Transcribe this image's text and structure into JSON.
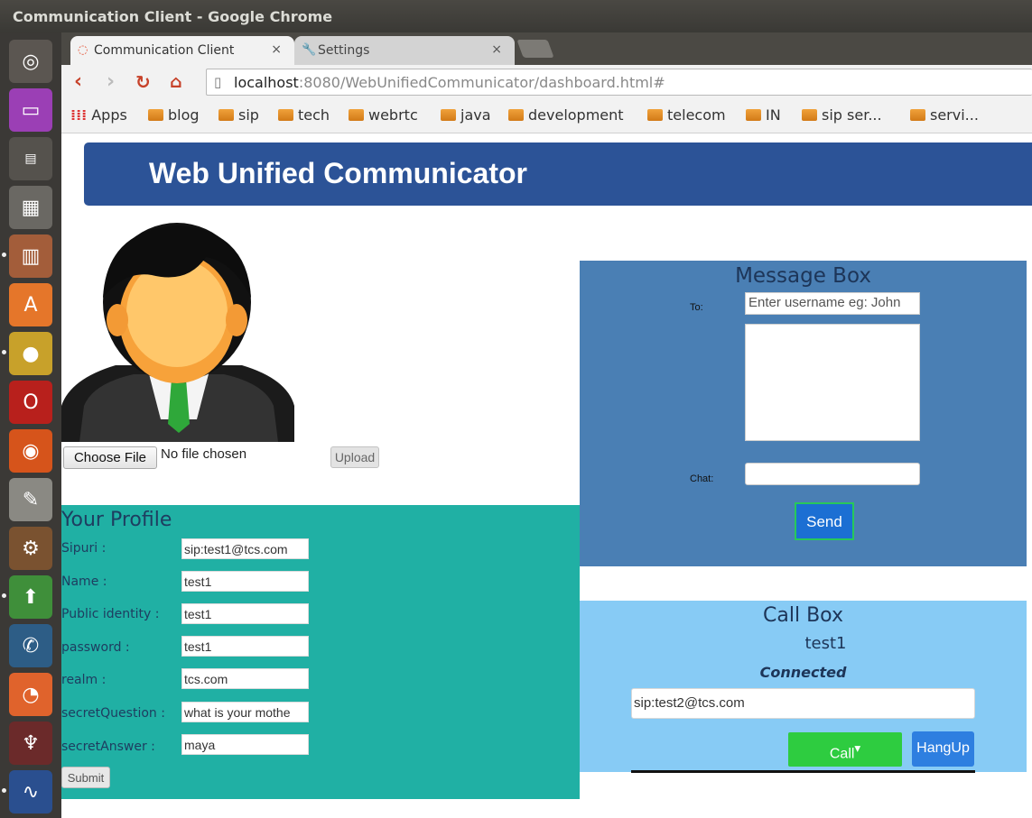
{
  "window": {
    "title": "Communication Client - Google Chrome"
  },
  "tabs": [
    {
      "label": "Communication Client",
      "close": "×"
    },
    {
      "label": "Settings",
      "close": "×"
    }
  ],
  "address_bar": {
    "host": "localhost",
    "rest": ":8080/WebUnifiedCommunicator/dashboard.html#"
  },
  "bookmarks": [
    "Apps",
    "blog",
    "sip",
    "tech",
    "webrtc",
    "java",
    "development",
    "telecom",
    "IN",
    "sip ser...",
    "servi..."
  ],
  "header": {
    "title": "Web Unified Communicator"
  },
  "upload": {
    "choose_label": "Choose File",
    "status": "No file chosen",
    "upload_label": "Upload"
  },
  "profile": {
    "title": "Your Profile",
    "fields": [
      {
        "label": "Sipuri :",
        "value": "sip:test1@tcs.com"
      },
      {
        "label": "Name :",
        "value": "test1"
      },
      {
        "label": "Public identity :",
        "value": "test1"
      },
      {
        "label": "password :",
        "value": "test1"
      },
      {
        "label": "realm :",
        "value": "tcs.com"
      },
      {
        "label": "secretQuestion :",
        "value": "what is your mothe"
      },
      {
        "label": "secretAnswer :",
        "value": "maya"
      }
    ],
    "submit_label": "Submit"
  },
  "message_box": {
    "title": "Message Box",
    "to_label": "To:",
    "to_placeholder": "Enter username eg: John",
    "chat_label": "Chat:",
    "send_label": "Send"
  },
  "call_box": {
    "title": "Call Box",
    "user": "test1",
    "status": "Connected",
    "target_uri": "sip:test2@tcs.com",
    "call_label": "Call",
    "call_caret": "▾",
    "hangup_label": "HangUp"
  },
  "colors": {
    "header": "#2c5397",
    "profile_panel": "#20b0a4",
    "message_panel": "#4a7fb4",
    "call_panel": "#87cbf5",
    "call_button": "#2ecc40",
    "hangup_button": "#2e7fe0",
    "send_button": "#1c6fd3"
  },
  "launcher_icons": [
    "ubuntu-dash-icon",
    "workspaces-icon",
    "files-small-icon",
    "calculator-icon",
    "file-manager-icon",
    "software-center-icon",
    "chrome-icon",
    "opera-icon",
    "firefox-icon",
    "text-editor-icon",
    "settings-gear-icon",
    "update-manager-icon",
    "phone-icon",
    "network-icon",
    "wine-icon",
    "system-monitor-icon"
  ]
}
